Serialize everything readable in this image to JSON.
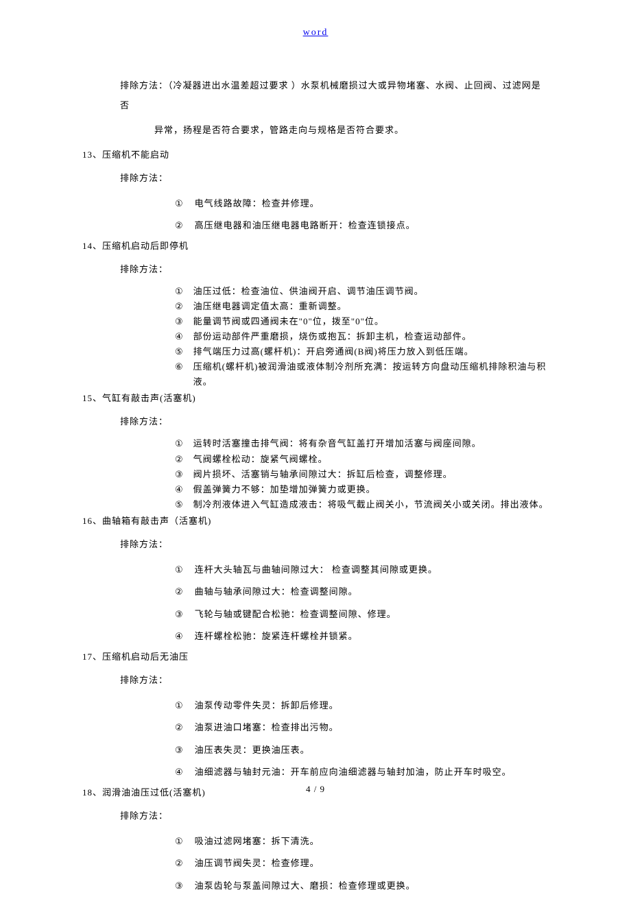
{
  "header": "word",
  "intro": {
    "line1": "排除方法：（冷凝器进出水温差超过要求 ）水泵机械磨损过大或异物堵塞、水阀、止回阀、过滤网是否",
    "line2": "异常，扬程是否符合要求，管路走向与规格是否符合要求。"
  },
  "sections": [
    {
      "title": "13、压缩机不能启动",
      "sub": "排除方法：",
      "style": "wide",
      "items": [
        {
          "m": "①",
          "t": "电气线路故障：检查并修理。"
        },
        {
          "m": "②",
          "t": "高压继电器和油压继电器电路断开：检查连锁接点。"
        }
      ]
    },
    {
      "title": "14、压缩机启动后即停机",
      "sub": "排除方法：",
      "style": "narrow",
      "items": [
        {
          "m": "①",
          "t": "油压过低：检查油位、供油阀开启、调节油压调节阀。"
        },
        {
          "m": "②",
          "t": "油压继电器调定值太高：重新调整。"
        },
        {
          "m": "③",
          "t": "能量调节阀或四通阀未在\"0\"位，拨至\"0\"位。"
        },
        {
          "m": "④",
          "t": "部份运动部件严重磨损，烧伤或抱瓦：拆卸主机，检查运动部件。"
        },
        {
          "m": "⑤",
          "t": "排气端压力过高(螺杆机)：开启旁通阀(B阀)将压力放入到低压端。"
        },
        {
          "m": "⑥",
          "t": "压缩机(螺杆机)被润滑油或液体制冷剂所充满：按运转方向盘动压缩机排除积油与积液。"
        }
      ]
    },
    {
      "title": "15、气缸有敲击声(活塞机)",
      "sub": "排除方法：",
      "style": "narrow",
      "items": [
        {
          "m": "①",
          "t": "运转时活塞撞击排气阀：将有杂音气缸盖打开增加活塞与阀座间隙。"
        },
        {
          "m": "②",
          "t": "气阀螺栓松动：旋紧气阀螺栓。"
        },
        {
          "m": "③",
          "t": "阀片损坏、活塞销与轴承间隙过大：拆缸后检查，调整修理。"
        },
        {
          "m": "④",
          "t": "假盖弹簧力不够：加垫增加弹簧力或更换。"
        },
        {
          "m": "⑤",
          "t": "制冷剂液体进入气缸造成液击：将吸气截止阀关小，节流阀关小或关闭。排出液体。"
        }
      ]
    },
    {
      "title": "16、曲轴箱有敲击声（活塞机)",
      "sub": "排除方法：",
      "style": "wide",
      "items": [
        {
          "m": "①",
          "t": "连杆大头轴瓦与曲轴间隙过大： 检查调整其间隙或更换。"
        },
        {
          "m": "②",
          "t": "曲轴与轴承间隙过大：检查调整间隙。"
        },
        {
          "m": "③",
          "t": "飞轮与轴或键配合松驰：检查调整间隙、修理。"
        },
        {
          "m": "④",
          "t": "连杆螺栓松驰：旋紧连杆螺栓并锁紧。"
        }
      ]
    },
    {
      "title": "17、压缩机启动后无油压",
      "sub": "排除方法：",
      "style": "wide",
      "items": [
        {
          "m": "①",
          "t": "油泵传动零件失灵：拆卸后修理。"
        },
        {
          "m": "②",
          "t": "油泵进油口堵塞：检查排出污物。"
        },
        {
          "m": "③",
          "t": "油压表失灵：更换油压表。"
        },
        {
          "m": "④",
          "t": "油细滤器与轴封元油：开车前应向油细滤器与轴封加油，防止开车时吸空。"
        }
      ]
    },
    {
      "title": "18、润滑油油压过低(活塞机)",
      "sub": "排除方法：",
      "style": "wide",
      "items": [
        {
          "m": "①",
          "t": "吸油过滤网堵塞：拆下清洗。"
        },
        {
          "m": "②",
          "t": "油压调节阀失灵：检查修理。"
        },
        {
          "m": "③",
          "t": "油泵齿轮与泵盖间隙过大、磨损：检查修理或更换。"
        }
      ]
    }
  ],
  "footer": "4 / 9"
}
